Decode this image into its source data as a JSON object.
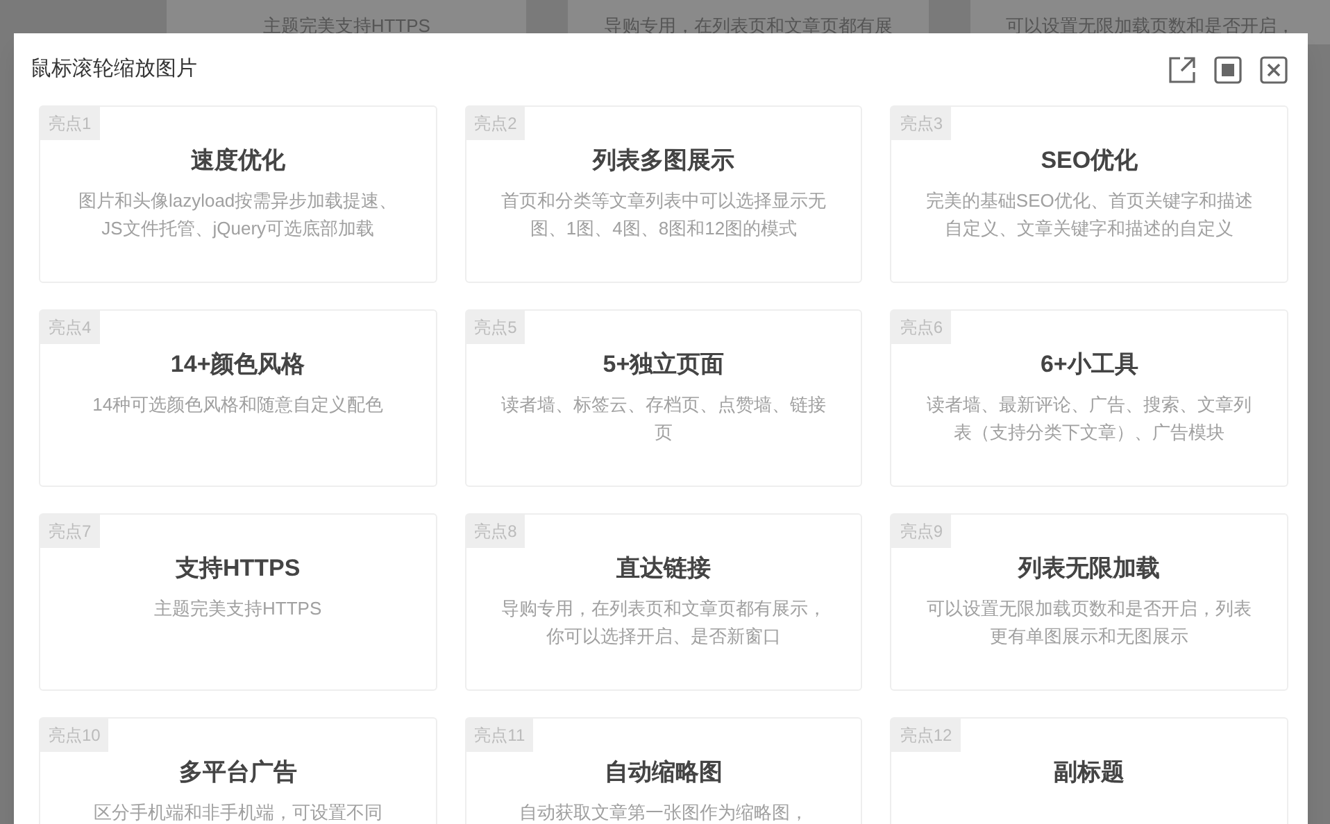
{
  "background_page": {
    "cards": [
      {
        "description": "主题完美支持HTTPS"
      },
      {
        "description": "导购专用，在列表页和文章页都有展"
      },
      {
        "description": "可以设置无限加载页数和是否开启，"
      }
    ]
  },
  "dialog": {
    "title": "鼠标滚轮缩放图片",
    "features": [
      {
        "tag": "亮点1",
        "title": "速度优化",
        "description": "图片和头像lazyload按需异步加载提速、JS文件托管、jQuery可选底部加载"
      },
      {
        "tag": "亮点2",
        "title": "列表多图展示",
        "description": "首页和分类等文章列表中可以选择显示无图、1图、4图、8图和12图的模式"
      },
      {
        "tag": "亮点3",
        "title": "SEO优化",
        "description": "完美的基础SEO优化、首页关键字和描述自定义、文章关键字和描述的自定义"
      },
      {
        "tag": "亮点4",
        "title": "14+颜色风格",
        "description": "14种可选颜色风格和随意自定义配色"
      },
      {
        "tag": "亮点5",
        "title": "5+独立页面",
        "description": "读者墙、标签云、存档页、点赞墙、链接页"
      },
      {
        "tag": "亮点6",
        "title": "6+小工具",
        "description": "读者墙、最新评论、广告、搜索、文章列表（支持分类下文章）、广告模块"
      },
      {
        "tag": "亮点7",
        "title": "支持HTTPS",
        "description": "主题完美支持HTTPS"
      },
      {
        "tag": "亮点8",
        "title": "直达链接",
        "description": "导购专用，在列表页和文章页都有展示，你可以选择开启、是否新窗口"
      },
      {
        "tag": "亮点9",
        "title": "列表无限加载",
        "description": "可以设置无限加载页数和是否开启，列表更有单图展示和无图展示"
      },
      {
        "tag": "亮点10",
        "title": "多平台广告",
        "description": "区分手机端和非手机端，可设置不同"
      },
      {
        "tag": "亮点11",
        "title": "自动缩略图",
        "description": "自动获取文章第一张图作为缩略图，"
      },
      {
        "tag": "亮点12",
        "title": "副标题"
      }
    ]
  }
}
